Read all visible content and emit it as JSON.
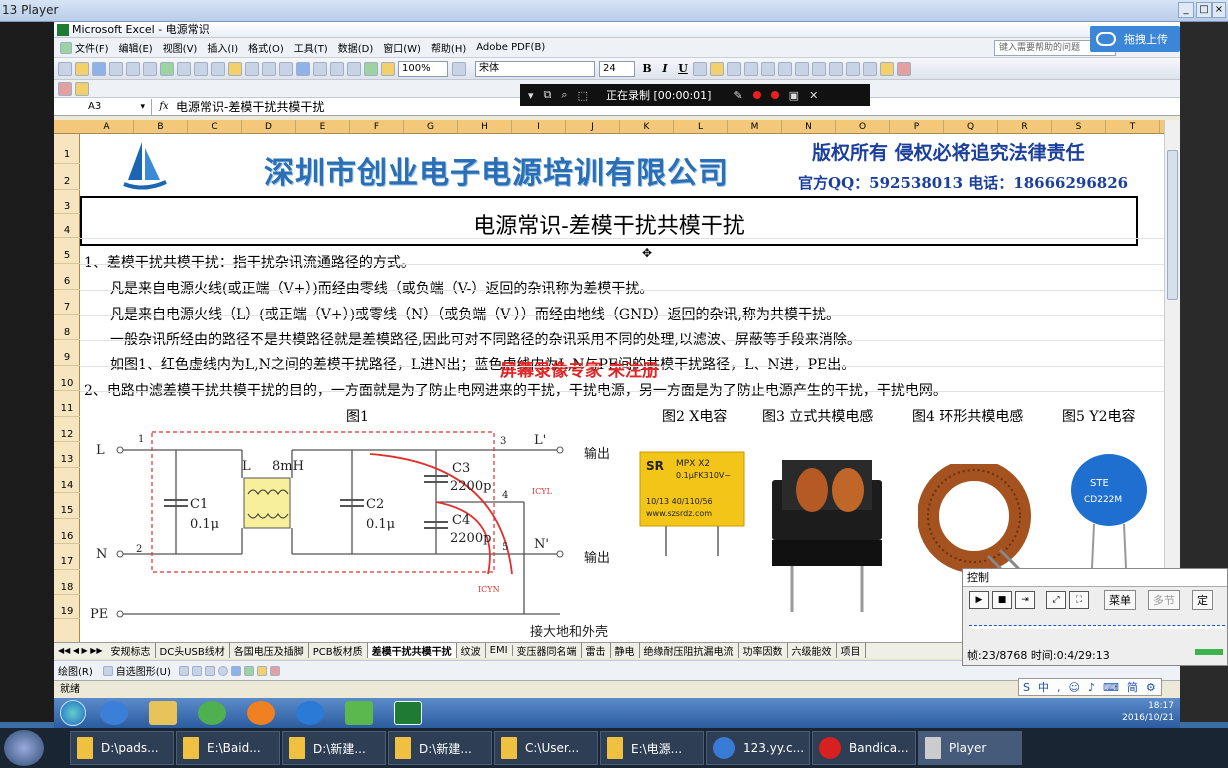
{
  "player": {
    "title": "13 Player"
  },
  "excel": {
    "title": "Microsoft Excel - 电源常识",
    "menu": [
      "文件(F)",
      "编辑(E)",
      "视图(V)",
      "插入(I)",
      "格式(O)",
      "工具(T)",
      "数据(D)",
      "窗口(W)",
      "帮助(H)",
      "Adobe PDF(B)"
    ],
    "help_placeholder": "键入需要帮助的问题",
    "zoom": "100%",
    "font_name": "宋体",
    "font_size": "24",
    "cell_ref": "A3",
    "formula": "电源常识-差模干扰共模干扰",
    "columns": [
      "A",
      "B",
      "C",
      "D",
      "E",
      "F",
      "G",
      "H",
      "I",
      "J",
      "K",
      "L",
      "M",
      "N",
      "O",
      "P",
      "Q",
      "R",
      "S",
      "T"
    ],
    "rows": [
      "1",
      "2",
      "3",
      "4",
      "5",
      "6",
      "7",
      "8",
      "9",
      "10",
      "11",
      "12",
      "13",
      "14",
      "15",
      "16",
      "17",
      "18",
      "19"
    ],
    "status": "就绪"
  },
  "recorder": {
    "status": "正在录制 [00:00:01]"
  },
  "baidu": {
    "label": "拖拽上传"
  },
  "sheet": {
    "company": "深圳市创业电子电源培训有限公司",
    "copyright": "版权所有  侵权必将追究法律责任",
    "contact": "官方QQ：592538013  电话：18666296826",
    "doc_title": "电源常识-差模干扰共模干扰",
    "lines": [
      "1、差模干扰共模干扰：指干扰杂讯流通路径的方式。",
      "凡是来自电源火线(或正端（V+）)而经由零线（或负端（V-）返回的杂讯称为差模干扰。",
      "凡是来自电源火线（L）(或正端（V+）)或零线（N）（或负端（V-））而经由地线（GND）返回的杂讯,称为共模干扰。",
      "一般杂讯所经由的路径不是共模路径就是差模路径,因此可对不同路径的杂讯采用不同的处理,以滤波、屏蔽等手段来消除。",
      "如图1、红色虚线内为L,N之间的差模干扰路径，L进N出；蓝色虚线内为L,N与PE间的共模干扰路径，L、N进，PE出。",
      "2、电路中滤差模干扰共模干扰的目的，一方面就是为了防止电网进来的干扰，干扰电源，另一方面是为了防止电源产生的干扰，干扰电网。"
    ],
    "watermark": "屏幕录像专家 未注册",
    "figures": [
      "图1",
      "图2 X电容",
      "图3 立式共模电感",
      "图4 环形共模电感",
      "图5 Y2电容"
    ],
    "circuit": {
      "L": "L",
      "N": "N",
      "PE": "PE",
      "n1": "1",
      "n2": "2",
      "n3": "3",
      "n4": "4",
      "n5": "5",
      "Lp": "L'",
      "Np": "N'",
      "C1": "C1",
      "C1v": "0.1μ",
      "C2": "C2",
      "C2v": "0.1μ",
      "Lind": "L",
      "Lval": "8mH",
      "C3": "C3",
      "C3v": "2200p",
      "C4": "C4",
      "C4v": "2200p",
      "icyl": "ICYL",
      "icyn": "ICYN",
      "out1": "输出",
      "out2": "输出",
      "ground": "接大地和外壳"
    },
    "xcap": {
      "brand": "SR",
      "l1": "MPX X2",
      "l2": "0.1μFK310V~",
      "l3": "10/13 40/110/56",
      "l4": "www.szsrdz.com"
    },
    "ycap": {
      "l1": "STE",
      "l2": "CD222M"
    }
  },
  "sheet_tabs": [
    "安规标志",
    "DC头USB线材",
    "各国电压及插脚",
    "PCB板材质",
    "差模干扰共模干扰",
    "纹波",
    "EMI",
    "变压器同名端",
    "雷击",
    "静电",
    "绝缘耐压阻抗漏电流",
    "功率因数",
    "六级能效",
    "项目"
  ],
  "active_tab": "差模干扰共模干扰",
  "drawbar": {
    "draw": "绘图(R)",
    "autoshape": "自选图形(U)"
  },
  "control": {
    "title": "控制",
    "menu": "菜单",
    "multi": "多节",
    "fix": "定",
    "frame": "帧:23/8768 时间:0:4/29:13"
  },
  "ime": [
    "中",
    "简"
  ],
  "clock": {
    "time": "18:17",
    "date": "2016/10/21"
  },
  "host_tasks": [
    "D:\\pads...",
    "E:\\Baid...",
    "D:\\新建...",
    "D:\\新建...",
    "C:\\User...",
    "E:\\电源...",
    "123.yy.c...",
    "Bandica...",
    "Player"
  ]
}
